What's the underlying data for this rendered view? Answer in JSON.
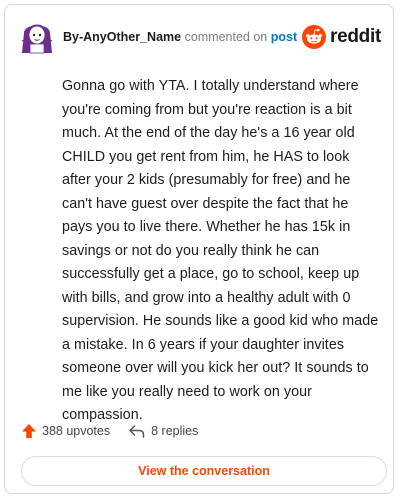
{
  "comment": {
    "username": "By-AnyOther_Name",
    "action_text": "commented on",
    "post_link_text": "post",
    "body": "Gonna go with YTA. I totally understand where you're coming from but you're reaction is a bit much. At the end of the day he's a 16 year old CHILD you get rent from him, he HAS to look after your 2 kids (presumably for free) and he can't have guest over despite the fact that he pays you to live there. Whether he has 15k in savings or not do you really think he can successfully get a place, go to school, keep up with bills, and grow into a healthy adult with 0 supervision. He sounds like a good kid who made a mistake. In 6 years if your daughter invites someone over will you kick her out? It sounds to me like you really need to work on your compassion."
  },
  "brand": {
    "wordmark": "reddit",
    "icon": "reddit-snoo-icon",
    "color": "#ff4500"
  },
  "stats": {
    "upvotes": "388 upvotes",
    "upvote_icon": "upvote-arrow-icon",
    "replies": "8 replies",
    "reply_icon": "reply-arrow-icon"
  },
  "cta": {
    "label": "View the conversation"
  },
  "colors": {
    "accent": "#ff4500",
    "link": "#0079d3",
    "avatar_purple": "#6b2e8c"
  }
}
